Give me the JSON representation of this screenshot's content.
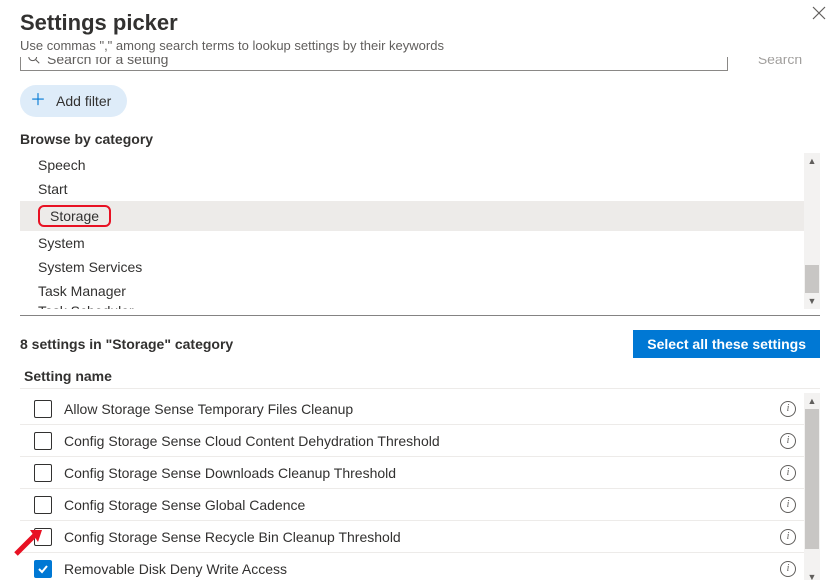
{
  "header": {
    "title": "Settings picker",
    "subtitle": "Use commas \",\" among search terms to lookup settings by their keywords"
  },
  "search": {
    "placeholder": "Search for a setting",
    "button_label": "Search"
  },
  "add_filter": {
    "label": "Add filter"
  },
  "categories": {
    "heading": "Browse by category",
    "items": [
      {
        "label": "Speech",
        "selected": false
      },
      {
        "label": "Start",
        "selected": false
      },
      {
        "label": "Storage",
        "selected": true
      },
      {
        "label": "System",
        "selected": false
      },
      {
        "label": "System Services",
        "selected": false
      },
      {
        "label": "Task Manager",
        "selected": false
      },
      {
        "label": "Task Scheduler",
        "selected": false
      }
    ]
  },
  "results": {
    "count_text": "8 settings in \"Storage\" category",
    "select_all_label": "Select all these settings",
    "column_header": "Setting name"
  },
  "settings": [
    {
      "label": "Allow Storage Sense Temporary Files Cleanup",
      "checked": false
    },
    {
      "label": "Config Storage Sense Cloud Content Dehydration Threshold",
      "checked": false
    },
    {
      "label": "Config Storage Sense Downloads Cleanup Threshold",
      "checked": false
    },
    {
      "label": "Config Storage Sense Global Cadence",
      "checked": false
    },
    {
      "label": "Config Storage Sense Recycle Bin Cleanup Threshold",
      "checked": false
    },
    {
      "label": "Removable Disk Deny Write Access",
      "checked": true
    }
  ],
  "colors": {
    "accent": "#0078d4",
    "annotation": "#e81123"
  }
}
